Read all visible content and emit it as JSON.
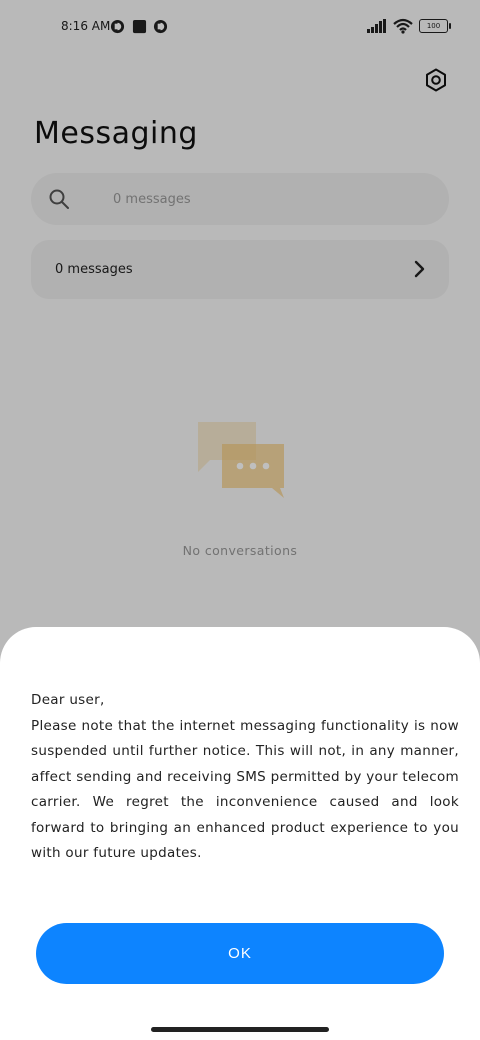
{
  "status_bar": {
    "time": "8:16 AM",
    "battery": "100",
    "icons": [
      "notification-app-icon",
      "notification-square-icon",
      "notification-app-icon",
      "signal-icon",
      "wifi-icon",
      "battery-icon"
    ]
  },
  "app": {
    "title": "Messaging",
    "search_placeholder": "0 messages",
    "row_label": "0 messages",
    "empty_text": "No conversations"
  },
  "dialog": {
    "greeting": "Dear user,",
    "body": "Please note that the internet messaging functionality is now suspended until further notice. This will not, in any manner, affect sending and receiving SMS permitted by your telecom carrier. We regret the inconvenience caused and look forward to bringing an enhanced product experience to you with our future updates.",
    "ok_label": "OK"
  },
  "colors": {
    "accent": "#0d84ff",
    "scrim": "rgba(0,0,0,0.25)",
    "illustration": "#f2c97a"
  }
}
